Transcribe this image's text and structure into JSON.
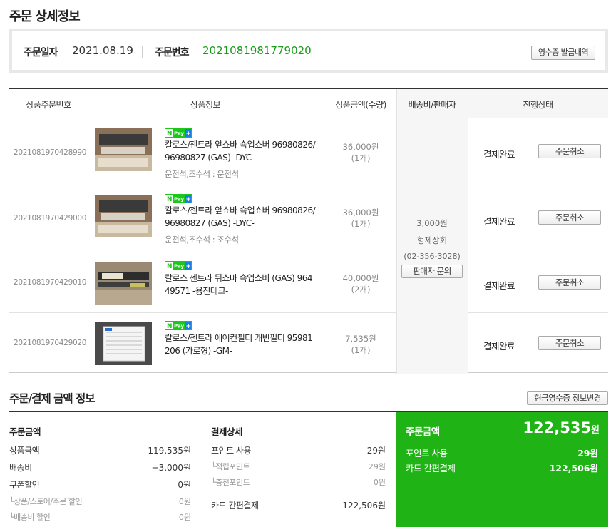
{
  "page_title": "주문 상세정보",
  "order_info": {
    "date_label": "주문일자",
    "date": "2021.08.19",
    "no_label": "주문번호",
    "order_no": "2021081981779020",
    "receipt_button": "영수증 발급내역"
  },
  "table": {
    "headers": [
      "상품주문번호",
      "상품정보",
      "상품금액(수량)",
      "배송비/판매자",
      "진행상태"
    ],
    "rows": [
      {
        "order_item_no": "2021081970428990",
        "badge": "N Pay +",
        "name_line1": "칼로스/젠트라 앞쇼바 쇽업쇼버 96980826/",
        "name_line2": "96980827 (GAS) -DYC-",
        "option": "운전석,조수석 : 운전석",
        "price": "36,000원",
        "qty": "(1개)",
        "status": "결제완료",
        "cancel": "주문취소"
      },
      {
        "order_item_no": "2021081970429000",
        "badge": "N Pay +",
        "name_line1": "칼로스/젠트라 앞쇼바 쇽업쇼버 96980826/",
        "name_line2": "96980827 (GAS) -DYC-",
        "option": "운전석,조수석 : 조수석",
        "price": "36,000원",
        "qty": "(1개)",
        "status": "결제완료",
        "cancel": "주문취소"
      },
      {
        "order_item_no": "2021081970429010",
        "badge": "N Pay +",
        "name_line1": "칼로스 젠트라 뒤쇼바 쇽업쇼버 (GAS) 964",
        "name_line2": "49571 -용진테크-",
        "option": "",
        "price": "40,000원",
        "qty": "(2개)",
        "status": "결제완료",
        "cancel": "주문취소"
      },
      {
        "order_item_no": "2021081970429020",
        "badge": "N Pay +",
        "name_line1": "칼로스/젠트라 에어컨필터 캐빈필터 95981",
        "name_line2": "206 (가로형) -GM-",
        "option": "",
        "price": "7,535원",
        "qty": "(1개)",
        "status": "결제완료",
        "cancel": "주문취소"
      }
    ],
    "shipping": {
      "fee": "3,000원",
      "seller": "형제상회",
      "phone": "(02-356-3028)",
      "inquiry_button": "판매자 문의"
    }
  },
  "payment": {
    "section_title": "주문/결제 금액 정보",
    "cash_receipt_button": "현금영수증 정보변경",
    "order_amount": {
      "title": "주문금액",
      "items": [
        {
          "label": "상품금액",
          "value": "119,535원",
          "sub": false
        },
        {
          "label": "배송비",
          "value": "+3,000원",
          "sub": false
        },
        {
          "label": "쿠폰할인",
          "value": "0원",
          "sub": false
        },
        {
          "label": "└상품/스토어/주문 할인",
          "value": "0원",
          "sub": true
        },
        {
          "label": "└배송비 할인",
          "value": "0원",
          "sub": true
        }
      ]
    },
    "payment_detail": {
      "title": "결제상세",
      "items": [
        {
          "label": "포인트 사용",
          "value": "29원",
          "sub": false
        },
        {
          "label": "└적립포인트",
          "value": "29원",
          "sub": true
        },
        {
          "label": "└충전포인트",
          "value": "0원",
          "sub": true
        },
        {
          "label": "카드 간편결제",
          "value": "122,506원",
          "sub": false
        }
      ]
    },
    "total": {
      "label": "주문금액",
      "amount": "122,535",
      "unit": "원",
      "items": [
        {
          "label": "포인트 사용",
          "value": "29원"
        },
        {
          "label": "카드 간편결제",
          "value": "122,506원"
        }
      ]
    }
  },
  "colors": {
    "accent_green": "#1fb315",
    "order_no_green": "#1a9a1a",
    "npay_green": "#19c819"
  }
}
